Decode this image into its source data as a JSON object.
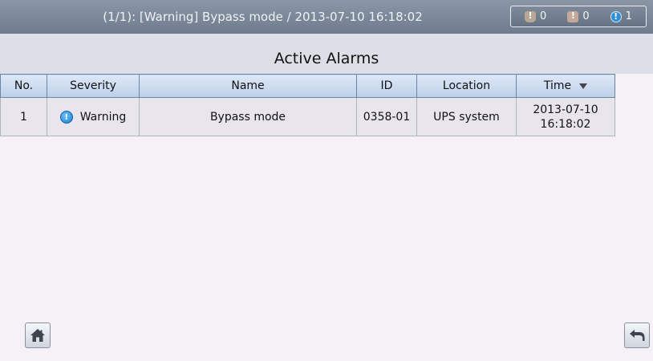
{
  "status_bar": {
    "message": "(1/1): [Warning] Bypass mode / 2013-07-10 16:18:02",
    "counters": [
      {
        "icon": "critical-alarm-icon",
        "count": "0"
      },
      {
        "icon": "major-alarm-icon",
        "count": "0"
      },
      {
        "icon": "minor-alarm-icon",
        "count": "1"
      }
    ]
  },
  "page": {
    "title": "Active Alarms"
  },
  "table": {
    "headers": [
      "No.",
      "Severity",
      "Name",
      "ID",
      "Location",
      "Time"
    ],
    "sort_column": "Time",
    "rows": [
      {
        "no": "1",
        "severity_icon": "warning-icon",
        "severity": "Warning",
        "name": "Bypass mode",
        "id": "0358-01",
        "location": "UPS system",
        "time_date": "2013-07-10",
        "time_clock": "16:18:02"
      }
    ]
  },
  "footer": {
    "home_icon": "home-icon",
    "back_icon": "back-arrow-icon"
  },
  "colors": {
    "status_bar": "#6f7c8d",
    "header_fill": "#bcd0ea",
    "row_fill": "#e8e6ec",
    "warning_blue": "#1b7fcf"
  }
}
